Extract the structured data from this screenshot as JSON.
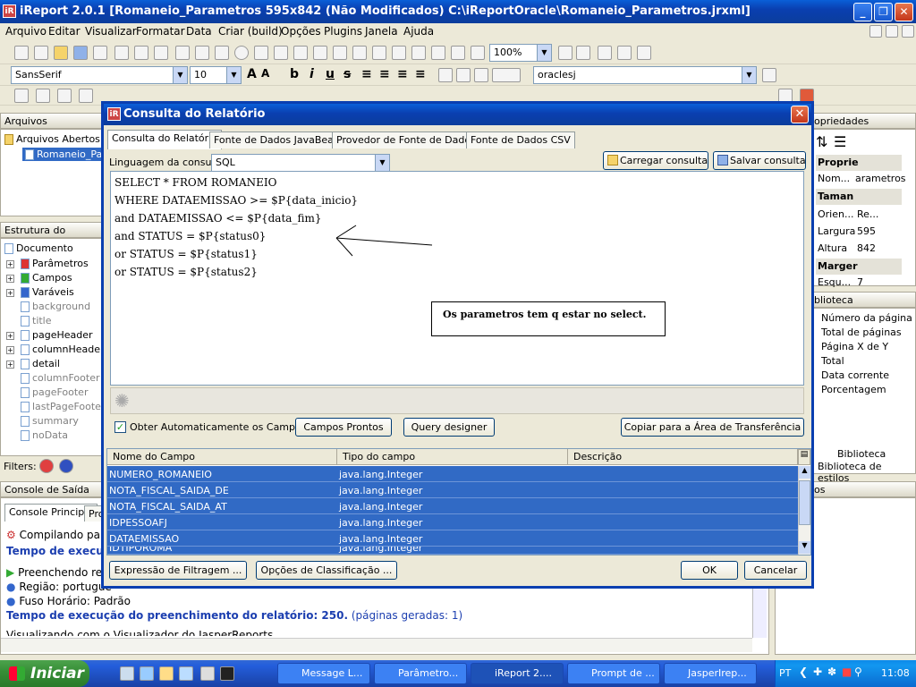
{
  "window": {
    "title": "iReport 2.0.1  [Romaneio_Parametros 595x842 (Não Modificados) C:\\iReportOracle\\Romaneio_Parametros.jrxml]"
  },
  "menu": [
    "Arquivo",
    "Editar",
    "Visualizar",
    "Formatar",
    "Data",
    "Criar (build)",
    "Opções",
    "Plugins",
    "Janela",
    "Ajuda"
  ],
  "toolbar": {
    "zoom": "100%",
    "font": "SansSerif",
    "font_size": "10",
    "connection": "oraclesj"
  },
  "files_panel": {
    "title": "Arquivos",
    "root": "Arquivos Abertos",
    "file": "Romaneio_Para"
  },
  "structure_panel": {
    "title": "Estrutura do documen",
    "root": "Documento",
    "items": [
      "Parâmetros",
      "Campos",
      "Varáveis",
      "background",
      "title",
      "pageHeader",
      "columnHeader",
      "detail",
      "columnFooter",
      "pageFooter",
      "lastPageFooter",
      "summary",
      "noData"
    ]
  },
  "filters_label": "Filters:",
  "properties_panel": {
    "title": "opriedades",
    "section1": "Proprie",
    "rows": [
      {
        "k": "Nom...",
        "v": "arametros"
      }
    ],
    "section2": "Taman",
    "rows2": [
      {
        "k": "Orien...",
        "v": "Re..."
      },
      {
        "k": "Largura",
        "v": "595"
      },
      {
        "k": "Altura",
        "v": "842"
      }
    ],
    "section3": "Marger",
    "rows3": [
      {
        "k": "Esqu...",
        "v": "7"
      }
    ]
  },
  "library_panel": {
    "title": "blioteca",
    "items": [
      "Número da página",
      "Total de páginas",
      "Página X de Y",
      "Total",
      "Data corrente",
      "Porcentagem"
    ],
    "tabs": [
      "Biblioteca",
      "Biblioteca de estilos"
    ]
  },
  "panel_os": "os",
  "output_panel": {
    "title": "Console de Saída",
    "tabs": [
      "Console Principal",
      "Pro"
    ],
    "lines": [
      {
        "text": "Compilando par",
        "style": "normal"
      },
      {
        "text": "Tempo de execuç",
        "style": "blue"
      },
      {
        "text": "Preenchendo rel",
        "style": "normal"
      },
      {
        "text": "Região: portugue",
        "style": "normal"
      },
      {
        "text": "Fuso Horário: Padrão",
        "style": "normal"
      },
      {
        "text": "Tempo de execução do preenchimento do relatório: 250.",
        "style": "blue",
        "suffix": " (páginas geradas: 1)"
      },
      {
        "text": "Visualizando com o Visualizador do JasperReports",
        "style": "normal"
      }
    ]
  },
  "dialog": {
    "title": "Consulta do Relatório",
    "tabs": [
      "Consulta do Relatório",
      "Fonte de Dados JavaBean",
      "Provedor de Fonte de Dados",
      "Fonte de Dados CSV"
    ],
    "language_label": "Linguagem da consulta",
    "language_value": "SQL",
    "load_button": "Carregar consulta",
    "save_button": "Salvar consulta",
    "sql": [
      "SELECT * FROM ROMANEIO",
      "WHERE DATAEMISSAO >= $P{data_inicio}",
      "and DATAEMISSAO <= $P{data_fim}",
      "and STATUS = $P{status0}",
      "or STATUS = $P{status1}",
      "or STATUS = $P{status2}"
    ],
    "note": "Os parametros tem q estar no select.",
    "auto_fields_label": "Obter Automaticamente os Campos",
    "ready_fields_button": "Campos Prontos",
    "query_designer_button": "Query designer",
    "copy_button": "Copiar para a Área de Transferência",
    "grid_headers": [
      "Nome do Campo",
      "Tipo do campo",
      "Descrição"
    ],
    "fields": [
      {
        "name": "NUMERO_ROMANEIO",
        "type": "java.lang.Integer"
      },
      {
        "name": "NOTA_FISCAL_SAIDA_DE",
        "type": "java.lang.Integer"
      },
      {
        "name": "NOTA_FISCAL_SAIDA_AT",
        "type": "java.lang.Integer"
      },
      {
        "name": "IDPESSOAFJ",
        "type": "java.lang.Integer"
      },
      {
        "name": "DATAEMISSAO",
        "type": "java.lang.Integer"
      },
      {
        "name": "IDTIPOROMA",
        "type": "java.lang.Integer"
      }
    ],
    "filter_button": "Expressão de Filtragem ...",
    "sort_button": "Opções de Classificação ...",
    "ok_button": "OK",
    "cancel_button": "Cancelar"
  },
  "taskbar": {
    "start": "Iniciar",
    "tasks": [
      "Message L...",
      "Parâmetro...",
      "iReport 2....",
      "Prompt de ...",
      "JasperIrep..."
    ],
    "lang": "PT",
    "clock": "11:08"
  }
}
